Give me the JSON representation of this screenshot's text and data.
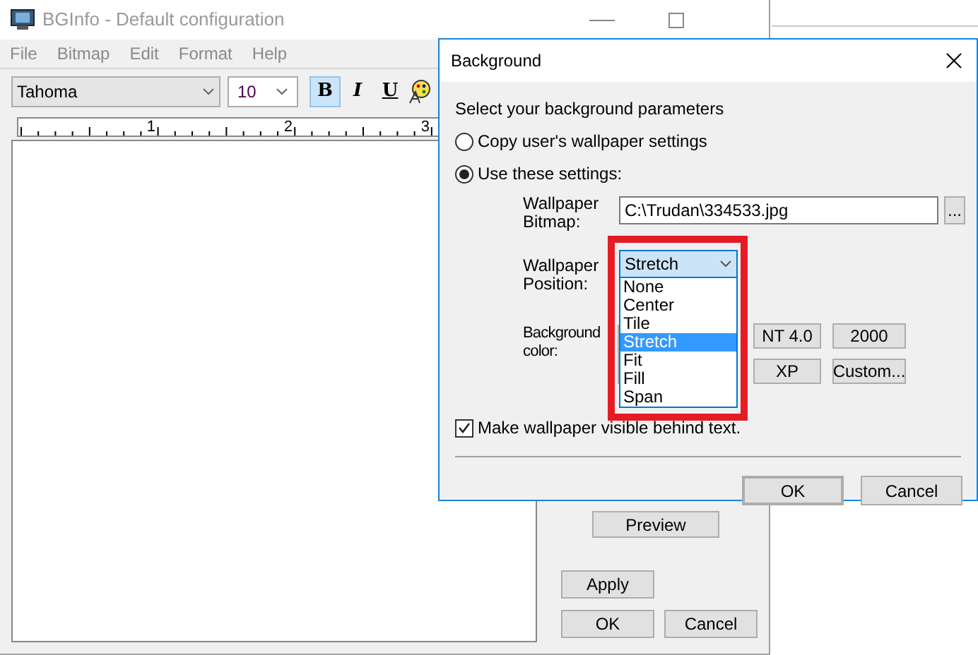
{
  "main_window": {
    "title": "BGInfo - Default configuration",
    "menu": [
      "File",
      "Bitmap",
      "Edit",
      "Format",
      "Help"
    ],
    "font_field": {
      "value": "Tahoma"
    },
    "size_field": {
      "value": "10"
    },
    "format_buttons": [
      {
        "label": "B",
        "kind": "bold",
        "selected": true
      },
      {
        "label": "I",
        "kind": "italic",
        "selected": false
      },
      {
        "label": "U",
        "kind": "underline",
        "selected": false
      }
    ],
    "ruler_labels": [
      "1",
      "2",
      "3"
    ],
    "preview_button": "Preview",
    "buttons": [
      "Apply",
      "OK",
      "Cancel"
    ]
  },
  "dialog": {
    "title": "Background",
    "prompt": "Select your background parameters",
    "options": [
      {
        "label": "Copy user's wallpaper settings",
        "selected": false
      },
      {
        "label": "Use these settings:",
        "selected": true
      }
    ],
    "bitmap_label": "Wallpaper Bitmap:",
    "bitmap_field": {
      "value": "C:\\Trudan\\334533.jpg"
    },
    "browse_button": "...",
    "position_label": "Wallpaper Position:",
    "position_combo": {
      "value": "Stretch",
      "options": [
        {
          "label": "None",
          "selected": false
        },
        {
          "label": "Center",
          "selected": false
        },
        {
          "label": "Tile",
          "selected": false
        },
        {
          "label": "Stretch",
          "selected": true
        },
        {
          "label": "Fit",
          "selected": false
        },
        {
          "label": "Fill",
          "selected": false
        },
        {
          "label": "Span",
          "selected": false
        }
      ]
    },
    "color_label": "Background color:",
    "color_buttons": [
      "NT 4.0",
      "2000",
      "XP",
      "Custom..."
    ],
    "visible_checkbox": {
      "label": "Make wallpaper visible behind text.",
      "checked": true
    },
    "buttons": [
      {
        "label": "OK",
        "default": true
      },
      {
        "label": "Cancel",
        "default": false
      }
    ]
  }
}
